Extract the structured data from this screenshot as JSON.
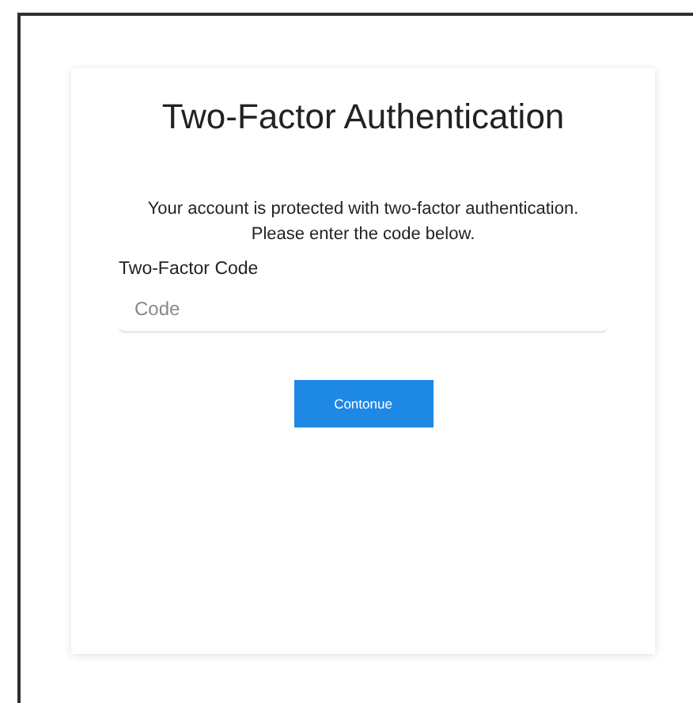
{
  "title": "Two-Factor Authentication",
  "message": [
    "Your account is protected with two-factor authentication.",
    "Please enter the code below."
  ],
  "field": {
    "label": "Two-Factor Code",
    "placeholder": "Code"
  },
  "button": "Contonue"
}
